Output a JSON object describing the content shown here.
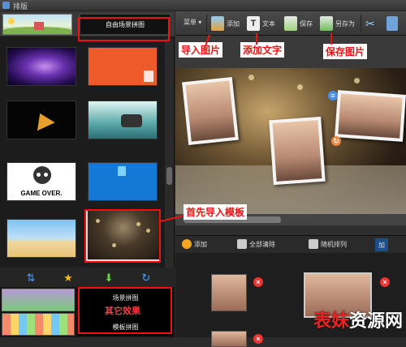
{
  "window": {
    "title": "排版"
  },
  "left": {
    "top_tab_label": "自由场景拼图",
    "thumb5_text": "GAME OVER.",
    "bottom_tab1_label": "场景拼图",
    "bottom_tab2_label": "模板拼图"
  },
  "toolbar": {
    "menu_label": "菜单 ▾",
    "add_label": "添加",
    "text_label": "文本",
    "save_label": "保存",
    "save_as_label": "另存为"
  },
  "layers": {
    "add_label": "添加",
    "clear_label": "全部清除",
    "random_label": "随机排列",
    "more_label": "加"
  },
  "annotations": {
    "import_image": "导入图片",
    "add_text": "添加文字",
    "save_image": "保存图片",
    "import_template_first": "首先导入模板",
    "other_effects": "其它效果"
  },
  "watermark": {
    "part1": "表妹",
    "part2": "资源网"
  }
}
